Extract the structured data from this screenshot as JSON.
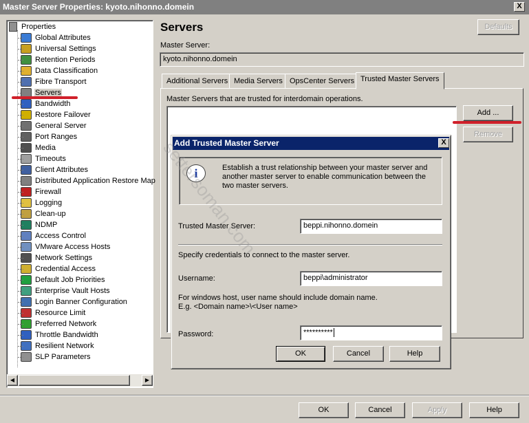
{
  "window": {
    "title": "Master Server Properties: kyoto.nihonno.domein",
    "close_label": "X"
  },
  "tree": {
    "root_label": "Properties",
    "items": [
      {
        "label": "Global Attributes",
        "icon": "global-attributes-icon",
        "color": "#3a7bd5"
      },
      {
        "label": "Universal Settings",
        "icon": "universal-settings-icon",
        "color": "#c8a020"
      },
      {
        "label": "Retention Periods",
        "icon": "retention-periods-icon",
        "color": "#409040"
      },
      {
        "label": "Data Classification",
        "icon": "data-classification-icon",
        "color": "#e0b030"
      },
      {
        "label": "Fibre Transport",
        "icon": "fibre-transport-icon",
        "color": "#5070b0"
      },
      {
        "label": "Servers",
        "icon": "servers-icon",
        "color": "#808080",
        "selected": true
      },
      {
        "label": "Bandwidth",
        "icon": "bandwidth-icon",
        "color": "#3060c0"
      },
      {
        "label": "Restore Failover",
        "icon": "restore-failover-icon",
        "color": "#d0b000"
      },
      {
        "label": "General Server",
        "icon": "general-server-icon",
        "color": "#707070"
      },
      {
        "label": "Port Ranges",
        "icon": "port-ranges-icon",
        "color": "#606060"
      },
      {
        "label": "Media",
        "icon": "media-icon",
        "color": "#505050"
      },
      {
        "label": "Timeouts",
        "icon": "timeouts-icon",
        "color": "#a0a0a0"
      },
      {
        "label": "Client Attributes",
        "icon": "client-attributes-icon",
        "color": "#4060a0"
      },
      {
        "label": "Distributed Application Restore Map",
        "icon": "distributed-restore-map-icon",
        "color": "#808080"
      },
      {
        "label": "Firewall",
        "icon": "firewall-icon",
        "color": "#c02020"
      },
      {
        "label": "Logging",
        "icon": "logging-icon",
        "color": "#e0c040"
      },
      {
        "label": "Clean-up",
        "icon": "clean-up-icon",
        "color": "#c0a040"
      },
      {
        "label": "NDMP",
        "icon": "ndmp-icon",
        "color": "#208060"
      },
      {
        "label": "Access Control",
        "icon": "access-control-icon",
        "color": "#6080c0"
      },
      {
        "label": "VMware Access Hosts",
        "icon": "vmware-access-hosts-icon",
        "color": "#7090c0"
      },
      {
        "label": "Network Settings",
        "icon": "network-settings-icon",
        "color": "#505050"
      },
      {
        "label": "Credential Access",
        "icon": "credential-access-icon",
        "color": "#d0b030"
      },
      {
        "label": "Default Job Priorities",
        "icon": "default-job-priorities-icon",
        "color": "#20a040"
      },
      {
        "label": "Enterprise Vault Hosts",
        "icon": "enterprise-vault-hosts-icon",
        "color": "#40a080"
      },
      {
        "label": "Login Banner Configuration",
        "icon": "login-banner-icon",
        "color": "#4070b0"
      },
      {
        "label": "Resource Limit",
        "icon": "resource-limit-icon",
        "color": "#c03030"
      },
      {
        "label": "Preferred Network",
        "icon": "preferred-network-icon",
        "color": "#30a030"
      },
      {
        "label": "Throttle Bandwidth",
        "icon": "throttle-bandwidth-icon",
        "color": "#3060c0"
      },
      {
        "label": "Resilient Network",
        "icon": "resilient-network-icon",
        "color": "#4070c0"
      },
      {
        "label": "SLP Parameters",
        "icon": "slp-parameters-icon",
        "color": "#909090"
      }
    ]
  },
  "main": {
    "heading": "Servers",
    "defaults_label": "Defaults",
    "master_server_label": "Master Server:",
    "master_server_value": "kyoto.nihonno.domein",
    "tabs": [
      {
        "label": "Additional Servers"
      },
      {
        "label": "Media Servers"
      },
      {
        "label": "OpsCenter Servers"
      },
      {
        "label": "Trusted Master Servers",
        "active": true
      }
    ],
    "trusted_desc": "Master Servers that are trusted for interdomain operations.",
    "add_label": "Add ...",
    "remove_label": "Remove"
  },
  "dialog": {
    "title": "Add Trusted Master Server",
    "close_label": "X",
    "info_text": "Establish a trust relationship between your master server and another master server to enable communication between the two master servers.",
    "trusted_label": "Trusted Master Server:",
    "trusted_value": "beppi.nihonno.domein",
    "credentials_text": "Specify credentials to connect to the master server.",
    "username_label": "Username:",
    "username_value": "beppi\\administrator",
    "hint_line1": "For windows host, user name should include domain name.",
    "hint_line2": "E.g.  <Domain name>\\<User name>",
    "password_label": "Password:",
    "password_value": "**********",
    "ok_label": "OK",
    "cancel_label": "Cancel",
    "help_label": "Help"
  },
  "footer": {
    "ok_label": "OK",
    "cancel_label": "Cancel",
    "apply_label": "Apply",
    "help_label": "Help"
  },
  "watermark": "settersoman.com",
  "colors": {
    "annotation_red": "#d0202a",
    "dialog_title_bg": "#0a246a",
    "window_title_bg": "#808080"
  }
}
